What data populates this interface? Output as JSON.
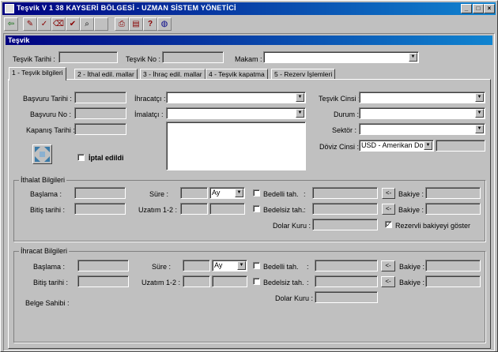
{
  "window": {
    "title": "Teşvik V 1 38 KAYSERİ BÖLGESİ - UZMAN SİSTEM YÖNETİCİ",
    "controls": [
      "_",
      "□",
      "×"
    ]
  },
  "subwindow": {
    "title": "Teşvik"
  },
  "header": {
    "tesvik_tarihi_label": "Teşvik Tarihi :",
    "tesvik_no_label": "Teşvik No :",
    "makam_label": "Makam :"
  },
  "tabs": [
    {
      "label": "1 - Teşvik bilgileri"
    },
    {
      "label": "2 - İthal edil. mallar"
    },
    {
      "label": "3 - İhraç edil. mallar"
    },
    {
      "label": "4 - Teşvik kapatma"
    },
    {
      "label": "5 - Rezerv İşlemleri"
    }
  ],
  "info": {
    "basvuru_tarihi": "Başvuru Tarihi :",
    "basvuru_no": "Başvuru No :",
    "kapanis_tarihi": "Kapanış Tarihi :",
    "ihracatci": "İhracatçı :",
    "imalatci": "İmalatçı :",
    "iptal_edildi": "İptal edildi",
    "tesvik_cinsi": "Teşvik Cinsi :",
    "durum": "Durum :",
    "sektor": "Sektör :",
    "doviz_cinsi": "Döviz Cinsi :",
    "doviz_value": "USD - Amerikan Dola"
  },
  "ithalat": {
    "title": "İthalat Bilgileri",
    "baslama": "Başlama :",
    "bitis": "Bitiş tarihi :",
    "sure": "Süre :",
    "sure_unit": "Ay",
    "uzatim": "Uzatım 1-2 :",
    "bedelli": "Bedelli tah.",
    "bedelsiz": "Bedelsiz tah.",
    "dolar_kuru": "Dolar Kuru :",
    "bakiye": "Bakiye :",
    "arrow_btn": "<-",
    "rezerv": "Rezervli bakiyeyi göster"
  },
  "ihracat": {
    "title": "İhracat Bilgileri",
    "baslama": "Başlama :",
    "bitis": "Bitiş tarihi :",
    "sure": "Süre :",
    "sure_unit": "Ay",
    "uzatim": "Uzatım 1-2 :",
    "bedelli": "Bedelli tah.",
    "bedelsiz": "Bedelsiz tah.",
    "dolar_kuru": "Dolar Kuru :",
    "bakiye": "Bakiye :",
    "arrow_btn": "<-",
    "belge_sahibi": "Belge Sahibi :"
  },
  "colors": {
    "titlebar": "#000080",
    "face": "#c0c0c0"
  }
}
